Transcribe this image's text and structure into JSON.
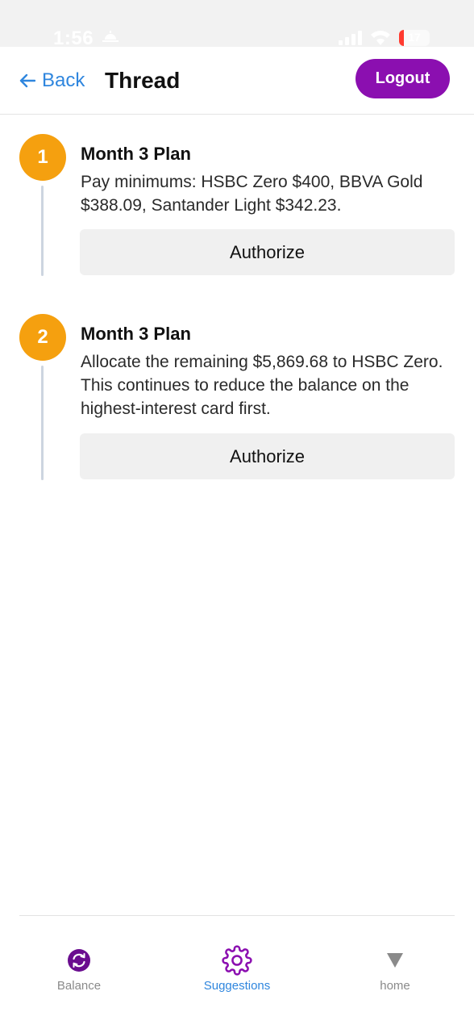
{
  "status_bar": {
    "time": "1:56",
    "battery": "17",
    "battery_level": 0.17,
    "battery_color": "#ff3b30"
  },
  "header": {
    "back_label": "Back",
    "title": "Thread",
    "logout_label": "Logout",
    "accent_color": "#8b0fb0",
    "link_color": "#2f86de"
  },
  "steps": [
    {
      "number": "1",
      "title": "Month 3 Plan",
      "description": "Pay minimums: HSBC Zero $400, BBVA Gold $388.09, Santander Light $342.23.",
      "button_label": "Authorize"
    },
    {
      "number": "2",
      "title": "Month 3 Plan",
      "description": "Allocate the remaining $5,869.68 to HSBC Zero. This continues to reduce the balance on the highest-interest card first.",
      "button_label": "Authorize"
    }
  ],
  "step_color": "#f5a00f",
  "bottom_nav": {
    "items": [
      {
        "label": "Balance",
        "icon": "refresh-circle-icon",
        "active": false
      },
      {
        "label": "Suggestions",
        "icon": "gear-icon",
        "active": true
      },
      {
        "label": "home",
        "icon": "triangle-down-icon",
        "active": false
      }
    ]
  }
}
